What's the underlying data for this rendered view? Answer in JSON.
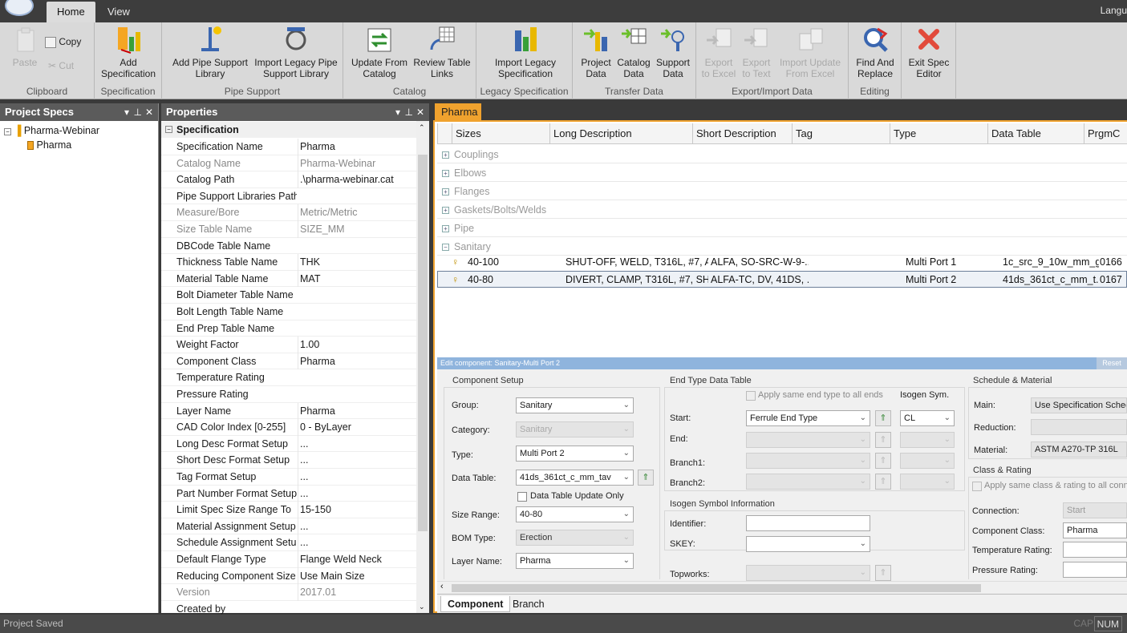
{
  "titlebar": {
    "tabs": [
      "Home",
      "View"
    ],
    "active_tab": "Home",
    "language_label": "Langu"
  },
  "ribbon": {
    "clipboard": {
      "label": "Clipboard",
      "paste": "Paste",
      "copy": "Copy",
      "cut": "Cut"
    },
    "specification": {
      "label": "Specification",
      "add_line1": "Add",
      "add_line2": "Specification"
    },
    "pipe_support": {
      "label": "Pipe Support",
      "add_line1": "Add Pipe Support",
      "add_line2": "Library",
      "import_line1": "Import Legacy Pipe",
      "import_line2": "Support Library"
    },
    "catalog": {
      "label": "Catalog",
      "update_line1": "Update From",
      "update_line2": "Catalog",
      "review_line1": "Review Table",
      "review_line2": "Links"
    },
    "legacy": {
      "label": "Legacy Specification",
      "import_line1": "Import Legacy",
      "import_line2": "Specification"
    },
    "transfer": {
      "label": "Transfer Data",
      "project_line1": "Project",
      "project_line2": "Data",
      "catalog_line1": "Catalog",
      "catalog_line2": "Data",
      "support_line1": "Support",
      "support_line2": "Data"
    },
    "export": {
      "label": "Export/Import Data",
      "excel_line1": "Export",
      "excel_line2": "to Excel",
      "text_line1": "Export",
      "text_line2": "to Text",
      "import_line1": "Import Update",
      "import_line2": "From Excel"
    },
    "editing": {
      "label": "Editing",
      "find_line1": "Find And",
      "find_line2": "Replace"
    },
    "exit": {
      "line1": "Exit Spec",
      "line2": "Editor"
    }
  },
  "project_specs": {
    "title": "Project Specs",
    "root": "Pharma-Webinar",
    "child": "Pharma"
  },
  "properties": {
    "title": "Properties",
    "section": "Specification",
    "rows": [
      {
        "name": "Specification Name",
        "value": "Pharma"
      },
      {
        "name": "Catalog Name",
        "value": "Pharma-Webinar"
      },
      {
        "name": "Catalog Path",
        "value": ".\\pharma-webinar.cat"
      },
      {
        "name": "Pipe Support Libraries Path",
        "value": ""
      },
      {
        "name": "Measure/Bore",
        "value": "Metric/Metric"
      },
      {
        "name": "Size Table Name",
        "value": "SIZE_MM"
      },
      {
        "name": "DBCode Table Name",
        "value": ""
      },
      {
        "name": "Thickness Table Name",
        "value": "THK"
      },
      {
        "name": "Material Table Name",
        "value": "MAT"
      },
      {
        "name": "Bolt Diameter Table Name",
        "value": ""
      },
      {
        "name": "Bolt Length Table Name",
        "value": ""
      },
      {
        "name": "End Prep Table Name",
        "value": ""
      },
      {
        "name": "Weight Factor",
        "value": "1.00"
      },
      {
        "name": "Component Class",
        "value": "Pharma"
      },
      {
        "name": "Temperature Rating",
        "value": ""
      },
      {
        "name": "Pressure Rating",
        "value": ""
      },
      {
        "name": "Layer Name",
        "value": "Pharma"
      },
      {
        "name": "CAD Color Index [0-255]",
        "value": "0 - ByLayer"
      },
      {
        "name": "Long Desc Format Setup",
        "value": "..."
      },
      {
        "name": "Short Desc Format Setup",
        "value": "..."
      },
      {
        "name": "Tag Format Setup",
        "value": "..."
      },
      {
        "name": "Part Number Format Setup",
        "value": "..."
      },
      {
        "name": "Limit Spec Size Range To",
        "value": "15-150"
      },
      {
        "name": "Material Assignment Setup",
        "value": "..."
      },
      {
        "name": "Schedule Assignment Setup",
        "value": "..."
      },
      {
        "name": "Default Flange Type",
        "value": "Flange Weld Neck"
      },
      {
        "name": "Reducing Component Size",
        "value": "Use Main Size"
      },
      {
        "name": "Version",
        "value": "2017.01"
      },
      {
        "name": "Created by",
        "value": ""
      }
    ]
  },
  "document": {
    "tab": "Pharma",
    "columns": [
      "Sizes",
      "Long Description",
      "Short Description",
      "Tag",
      "Type",
      "Data Table",
      "PrgmC"
    ],
    "categories": [
      "Couplings",
      "Elbows",
      "Flanges",
      "Gaskets/Bolts/Welds",
      "Pipe",
      "Sanitary"
    ],
    "rows": [
      {
        "sizes": "40-100",
        "long": "SHUT-OFF, WELD, T316L, #7, A...",
        "short": "ALFA, SO-SRC-W-9-...",
        "tag": "",
        "type": "Multi Port 1",
        "table": "1c_src_9_10w_mm_g...",
        "prgm": "0166"
      },
      {
        "sizes": "40-80",
        "long": "DIVERT, CLAMP, T316L, #7, SH...",
        "short": "ALFA-TC, DV, 41DS, ...",
        "tag": "",
        "type": "Multi Port 2",
        "table": "41ds_361ct_c_mm_t...",
        "prgm": "0167"
      }
    ],
    "edit_header": "Edit component: Sanitary-Multi Port 2",
    "reset_label": "Reset",
    "component_setup": {
      "title": "Component Setup",
      "group_label": "Group:",
      "group_value": "Sanitary",
      "category_label": "Category:",
      "category_value": "Sanitary",
      "type_label": "Type:",
      "type_value": "Multi Port 2",
      "data_table_label": "Data Table:",
      "data_table_value": "41ds_361ct_c_mm_tav",
      "update_only_label": "Data Table Update Only",
      "size_range_label": "Size Range:",
      "size_range_value": "40-80",
      "bom_label": "BOM Type:",
      "bom_value": "Erection",
      "layer_label": "Layer Name:",
      "layer_value": "Pharma"
    },
    "end_type": {
      "title": "End Type Data Table",
      "same_label": "Apply same end type to all ends",
      "isogen_sym_label": "Isogen Sym.",
      "start_label": "Start:",
      "start_value": "Ferrule End Type",
      "start_sym": "CL",
      "end_label": "End:",
      "branch1_label": "Branch1:",
      "branch2_label": "Branch2:"
    },
    "isogen": {
      "title": "Isogen Symbol Information",
      "identifier_label": "Identifier:",
      "skey_label": "SKEY:",
      "topworks_label": "Topworks:"
    },
    "schedule": {
      "title": "Schedule & Material",
      "main_label": "Main:",
      "main_value": "Use Specification Schedu",
      "reduction_label": "Reduction:",
      "material_label": "Material:",
      "material_value": "ASTM A270-TP 316L"
    },
    "class_rating": {
      "title": "Class & Rating",
      "same_label": "Apply same class & rating to all conne",
      "connection_label": "Connection:",
      "connection_value": "Start",
      "class_label": "Component Class:",
      "class_value": "Pharma",
      "temp_label": "Temperature Rating:",
      "pressure_label": "Pressure Rating:"
    },
    "bottom_tabs": [
      "Component",
      "Branch"
    ]
  },
  "status": {
    "text": "Project Saved",
    "cap": "CAP",
    "num": "NUM"
  }
}
